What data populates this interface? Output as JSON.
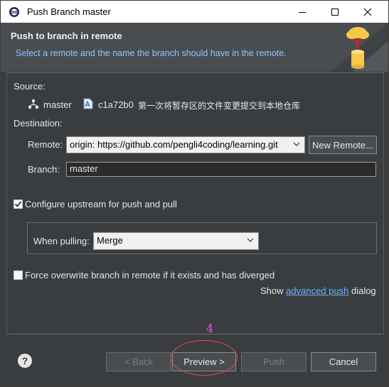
{
  "window": {
    "title": "Push Branch master",
    "minimize_glyph": "—",
    "maximize_glyph": "☐",
    "close_glyph": "✕"
  },
  "banner": {
    "heading": "Push to branch in remote",
    "description": "Select a remote and the name the branch should have in the remote."
  },
  "source": {
    "label": "Source:",
    "branch": "master",
    "commit_id": "c1a72b0",
    "commit_message": "第一次将暂存区的文件变更提交到本地仓库"
  },
  "destination": {
    "label": "Destination:",
    "remote_label": "Remote:",
    "remote_value": "origin: https://github.com/pengli4coding/learning.git",
    "new_remote_button": "New Remote...",
    "branch_label": "Branch:",
    "branch_value": "master"
  },
  "options": {
    "configure_upstream_label": "Configure upstream for push and pull",
    "configure_upstream_checked": true,
    "when_pulling_label": "When pulling:",
    "when_pulling_value": "Merge",
    "force_overwrite_label": "Force overwrite branch in remote if it exists and has diverged",
    "force_overwrite_checked": false,
    "show_prefix": "Show",
    "advanced_push_link": "advanced push",
    "show_suffix": "dialog"
  },
  "buttons": {
    "help": "?",
    "back": "< Back",
    "preview": "Preview >",
    "push": "Push",
    "cancel": "Cancel"
  },
  "annotation": {
    "step_number": "4"
  },
  "icons": {
    "app": "eclipse-icon",
    "branch": "branch-icon",
    "commit": "commit-icon",
    "wizard": "push-wizard-icon",
    "dropdown": "chevron-down-icon",
    "help": "help-icon"
  },
  "colors": {
    "background": "#3a3d3f",
    "banner": "#4a4d50",
    "link": "#6ab4ff",
    "annotation": "#ff4ad8"
  }
}
